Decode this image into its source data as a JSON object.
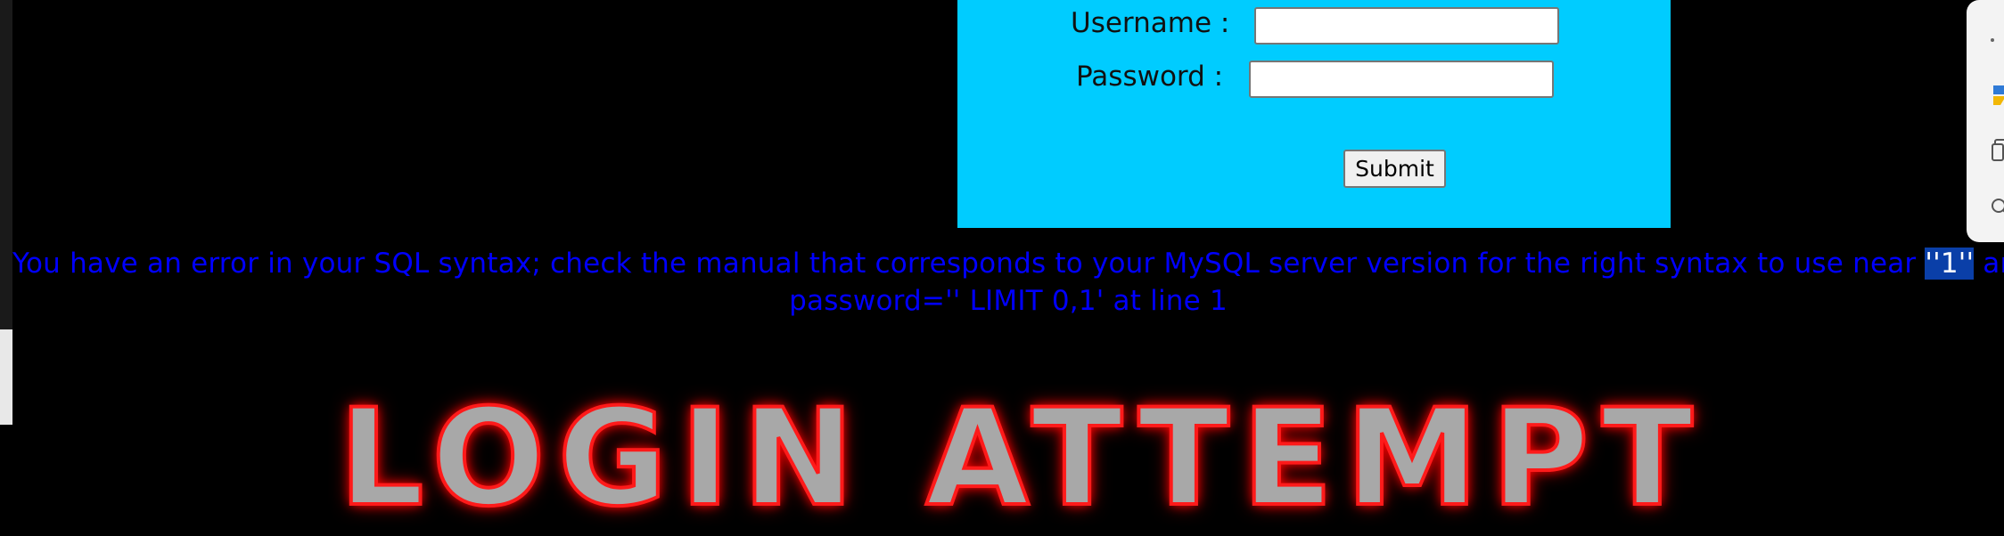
{
  "login_form": {
    "username_label": "Username :",
    "password_label": "Password :",
    "username_value": "",
    "password_value": "",
    "submit_label": "Submit"
  },
  "sql_error": {
    "line1_before": "You have an error in your SQL syntax; check the manual that corresponds to your MySQL server version for the right syntax to use near ",
    "line1_highlight": "''1''",
    "line1_after": " and",
    "line2": "password='' LIMIT 0,1' at line 1"
  },
  "banner": {
    "text": "LOGIN ATTEMPT"
  },
  "side_dock": {
    "icons": [
      "more-icon",
      "app-icon",
      "copy-icon",
      "search-icon"
    ]
  },
  "colors": {
    "page_background": "#000000",
    "panel_background": "#00ccff",
    "error_text": "#0000ff",
    "selection_highlight": "#0a3fa8",
    "banner_glow": "#ff1a1a"
  }
}
